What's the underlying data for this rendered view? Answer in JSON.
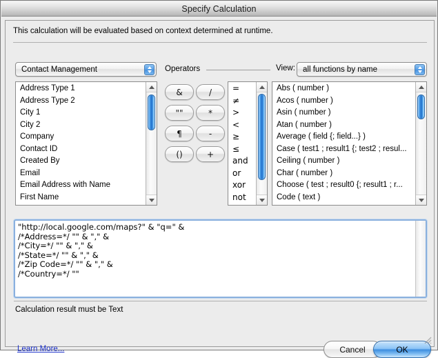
{
  "window": {
    "title": "Specify Calculation"
  },
  "intro": {
    "text": "This calculation will be evaluated based on context determined at runtime."
  },
  "field_source": {
    "selected": "Contact Management",
    "arrow_up_icon": "triangle-up-icon",
    "arrow_down_icon": "triangle-down-icon"
  },
  "fields_list": {
    "items": [
      "Address Type 1",
      "Address Type 2",
      "City 1",
      "City 2",
      "Company",
      "Contact ID",
      "Created By",
      "Email",
      "Email Address with Name",
      "First Name"
    ]
  },
  "operators": {
    "label": "Operators",
    "buttons": [
      {
        "label": "&",
        "name": "operator-button-ampersand"
      },
      {
        "label": "/",
        "name": "operator-button-divide"
      },
      {
        "label": "\"\"",
        "name": "operator-button-quotes"
      },
      {
        "label": "*",
        "name": "operator-button-multiply"
      },
      {
        "label": "¶",
        "name": "operator-button-pilcrow"
      },
      {
        "label": "-",
        "name": "operator-button-minus"
      },
      {
        "label": "()",
        "name": "operator-button-parentheses"
      },
      {
        "label": "+",
        "name": "operator-button-plus"
      }
    ],
    "list": [
      "=",
      "≠",
      ">",
      "<",
      "≥",
      "≤",
      "and",
      "or",
      "xor",
      "not"
    ]
  },
  "view": {
    "label": "View:",
    "selected": "all functions by name"
  },
  "functions_list": {
    "items": [
      "Abs ( number )",
      "Acos ( number )",
      "Asin ( number )",
      "Atan ( number )",
      "Average ( field {; field...} )",
      "Case ( test1 ; result1 {; test2 ; resul...",
      "Ceiling ( number )",
      "Char ( number )",
      "Choose ( test ; result0 {; result1 ; r...",
      "Code ( text )"
    ]
  },
  "formula": {
    "value": "\"http://local.google.com/maps?\" & \"q=\" &\n/*Address=*/ \"\" & \",\" &\n/*City=*/ \"\" & \",\" &\n/*State=*/ \"\" & \",\" &\n/*Zip Code=*/ \"\" & \",\" &\n/*Country=*/ \"\""
  },
  "result": {
    "text": "Calculation result must be Text"
  },
  "footer": {
    "learn_more": "Learn More...",
    "cancel_label": "Cancel",
    "ok_label": "OK"
  },
  "colors": {
    "window_bg": "#ececec",
    "accent_blue": "#3e8fe0",
    "link_blue": "#1c31c8",
    "focus_ring": "#8ab0de"
  }
}
